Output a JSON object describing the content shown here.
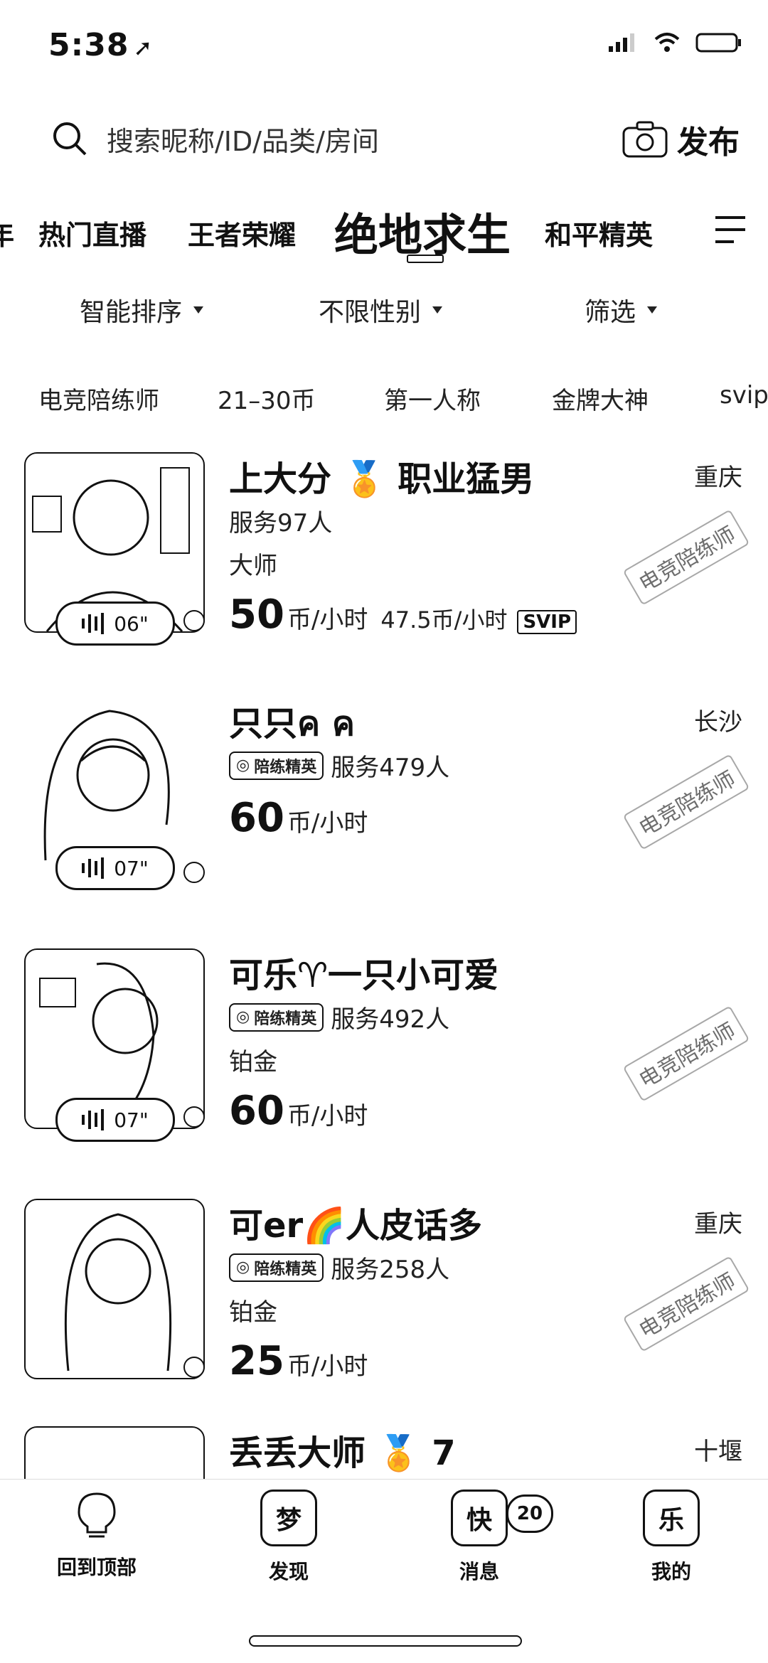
{
  "status": {
    "time": "5:38"
  },
  "search": {
    "placeholder": "搜索昵称/ID/品类/房间",
    "publish_label": "发布"
  },
  "tabs": [
    {
      "label": "年"
    },
    {
      "label": "热门直播"
    },
    {
      "label": "王者荣耀"
    },
    {
      "label": "绝地求生",
      "active": true
    },
    {
      "label": "和平精英"
    }
  ],
  "filters": [
    {
      "label": "智能排序"
    },
    {
      "label": "不限性别"
    },
    {
      "label": "筛选"
    }
  ],
  "tags": [
    "电竞陪练师",
    "21–30币",
    "第一人称",
    "金牌大神",
    "svip"
  ],
  "cards": [
    {
      "name": "上大分 🏅 职业猛男",
      "city": "重庆",
      "line2": "服务97人",
      "level": "大师",
      "price": "50",
      "unit": "币/小时",
      "alt_price": "47.5币/小时",
      "svip": "SVIP",
      "voice": "06\"",
      "stamp": "电竞陪练师"
    },
    {
      "name": "只只ค ค",
      "city": "长沙",
      "badge": "陪练精英",
      "line2": "服务479人",
      "price": "60",
      "unit": "币/小时",
      "voice": "07\"",
      "stamp": "电竞陪练师"
    },
    {
      "name": "可乐♈一只小可爱",
      "city": "",
      "badge": "陪练精英",
      "line2": "服务492人",
      "level": "铂金",
      "price": "60",
      "unit": "币/小时",
      "voice": "07\"",
      "stamp": "电竞陪练师"
    },
    {
      "name": "可er🌈人皮话多",
      "city": "重庆",
      "badge": "陪练精英",
      "line2": "服务258人",
      "level": "铂金",
      "price": "25",
      "unit": "币/小时",
      "stamp": "电竞陪练师"
    },
    {
      "name": "丢丢大师 🏅 7",
      "city": "十堰"
    }
  ],
  "nav": [
    {
      "label": "回到顶部",
      "icon": "bulb-icon"
    },
    {
      "label": "发现",
      "icon_text": "梦"
    },
    {
      "label": "消息",
      "icon_text": "快",
      "badge": "20"
    },
    {
      "label": "我的",
      "icon_text": "乐"
    }
  ]
}
